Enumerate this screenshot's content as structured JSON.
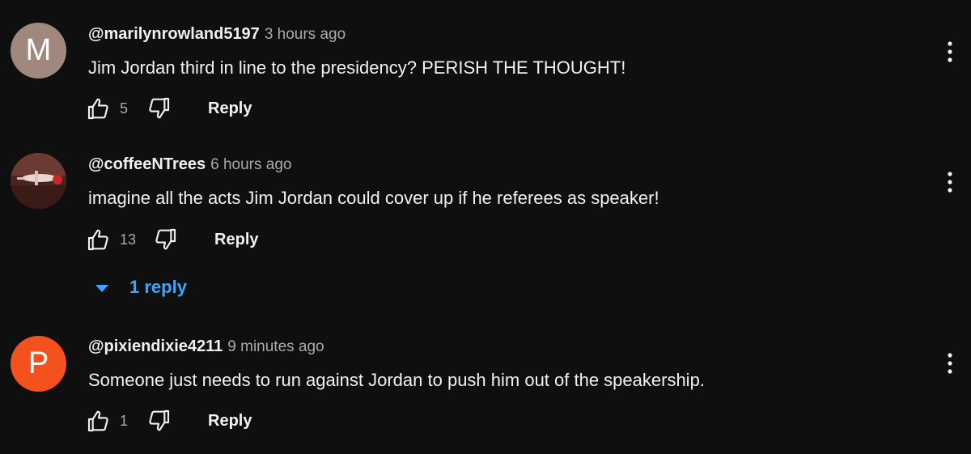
{
  "comments": [
    {
      "avatar_letter": "M",
      "avatar_color": "#a1887f",
      "author": "@marilynrowland5197",
      "time": "3 hours ago",
      "text": "Jim Jordan third in line to the presidency? PERISH THE THOUGHT!",
      "likes": "5",
      "reply_label": "Reply"
    },
    {
      "avatar_letter": "",
      "avatar_color": "#5a2a24",
      "author": "@coffeeNTrees",
      "time": "6 hours ago",
      "text": "imagine all the acts Jim Jordan could cover up if he referees as speaker!",
      "likes": "13",
      "reply_label": "Reply",
      "replies_label": "1 reply"
    },
    {
      "avatar_letter": "P",
      "avatar_color": "#f4511e",
      "author": "@pixiendixie4211",
      "time": "9 minutes ago",
      "text": "Someone just needs to run against Jordan to push him out of the speakership.",
      "likes": "1",
      "reply_label": "Reply"
    }
  ],
  "icons": {
    "like": "thumb-up-icon",
    "dislike": "thumb-down-icon",
    "more": "more-vert-icon",
    "expand": "arrow-drop-down-icon"
  },
  "colors": {
    "background": "#0f0f0f",
    "link": "#3ea6ff",
    "secondary_text": "#aaaaaa"
  }
}
